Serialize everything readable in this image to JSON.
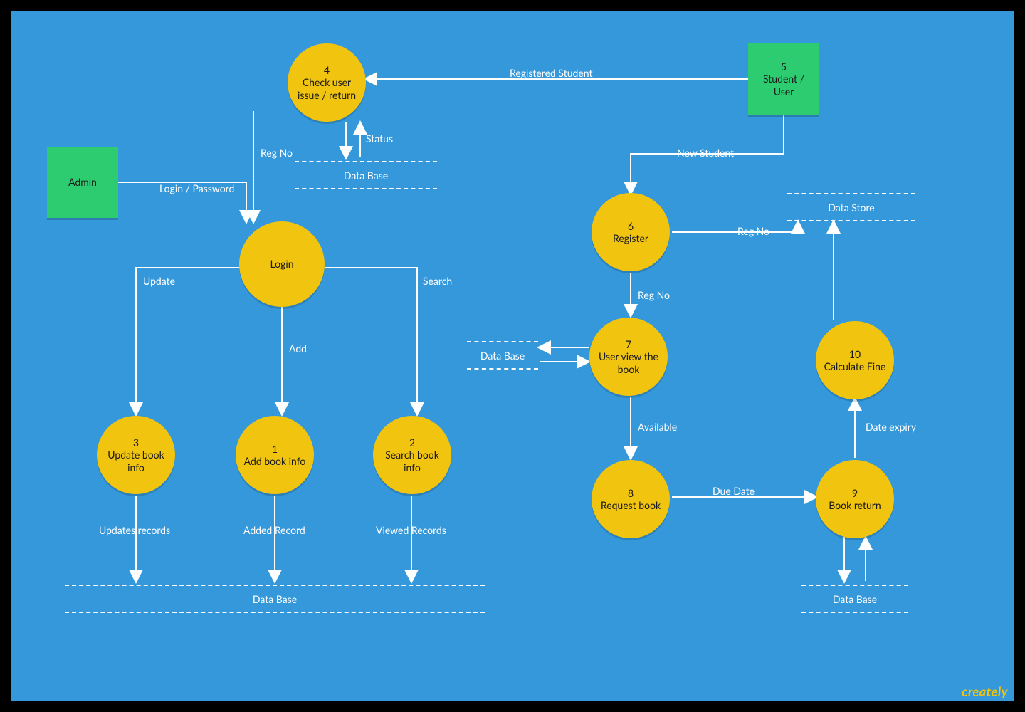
{
  "entities": {
    "admin": {
      "label": "Admin"
    },
    "student_user": {
      "num": "5",
      "label": "Student / User"
    }
  },
  "processes": {
    "check_user": {
      "num": "4",
      "title": "Check user issue / return"
    },
    "login": {
      "title": "Login"
    },
    "update_book": {
      "num": "3",
      "title": "Update book info"
    },
    "add_book": {
      "num": "1",
      "title": "Add book info"
    },
    "search_book": {
      "num": "2",
      "title": "Search book info"
    },
    "register": {
      "num": "6",
      "title": "Register"
    },
    "user_view": {
      "num": "7",
      "title": "User view the book"
    },
    "request_book": {
      "num": "8",
      "title": "Request book"
    },
    "book_return": {
      "num": "9",
      "title": "Book return"
    },
    "calc_fine": {
      "num": "10",
      "title": "Calculate Fine"
    }
  },
  "stores": {
    "db_check": {
      "label": "Data Base"
    },
    "db_bottom": {
      "label": "Data Base"
    },
    "db_user": {
      "label": "Data Base"
    },
    "db_return": {
      "label": "Data Base"
    },
    "data_store": {
      "label": "Data Store"
    }
  },
  "flows": {
    "registered_student": "Registered Student",
    "status": "Status",
    "reg_no_check": "Reg No",
    "login_password": "Login / Password",
    "update": "Update",
    "add": "Add",
    "search": "Search",
    "updates_records": "Updates records",
    "added_record": "Added Record",
    "viewed_records": "Viewed Records",
    "new_student": "New Student",
    "reg_no_register": "Reg No",
    "reg_no_view": "Reg No",
    "available": "Available",
    "due_date": "Due Date",
    "date_expiry": "Date expiry",
    "reg_no_out": "Reg No"
  },
  "branding": "creately"
}
